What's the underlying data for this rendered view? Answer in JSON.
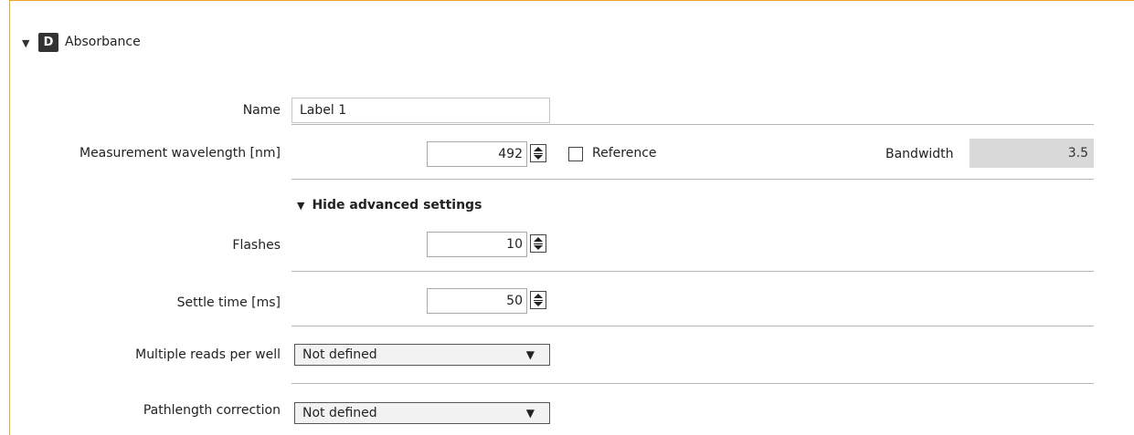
{
  "section": {
    "collapse_glyph": "▼",
    "badge": "D",
    "title": "Absorbance"
  },
  "name_field": {
    "label": "Name",
    "value": "Label 1"
  },
  "measurement": {
    "label": "Measurement wavelength [nm]",
    "value": "492",
    "reference_label": "Reference",
    "reference_checked": false,
    "bandwidth_label": "Bandwidth",
    "bandwidth_value": "3.5"
  },
  "advanced": {
    "toggle_glyph": "▼",
    "toggle_label": "Hide advanced settings"
  },
  "flashes": {
    "label": "Flashes",
    "value": "10"
  },
  "settle_time": {
    "label": "Settle time [ms]",
    "value": "50"
  },
  "multiple_reads": {
    "label": "Multiple reads per well",
    "value": "Not defined",
    "arrow": "▼"
  },
  "pathlength": {
    "label": "Pathlength correction",
    "value": "Not defined",
    "arrow": "▼"
  },
  "colors": {
    "frame_accent": "#e8a42a",
    "badge_bg": "#333333",
    "readonly_bg": "#d9d9d9",
    "divider": "#b5b5b5"
  },
  "icons": {
    "collapse": "triangle-down-icon",
    "spinner": "spinner-updown-icon",
    "dropdown": "chevron-down-icon"
  }
}
